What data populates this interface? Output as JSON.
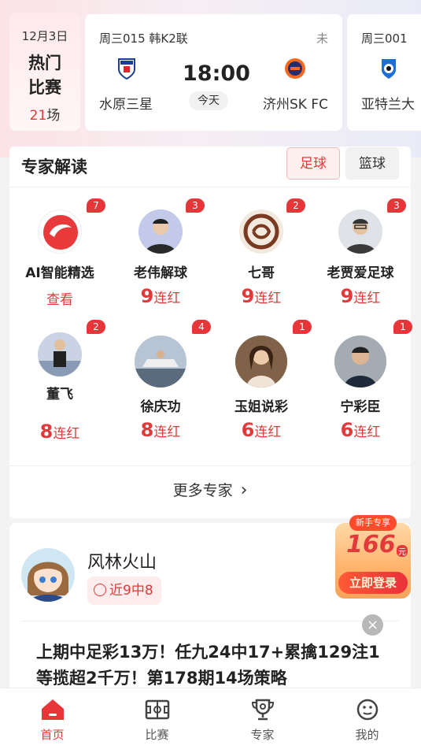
{
  "hot_matches": {
    "date": "12月3日",
    "title_line1": "热门",
    "title_line2": "比赛",
    "count": "21",
    "count_unit": "场",
    "matches": [
      {
        "league": "周三015 韩K2联",
        "status": "未",
        "home": "水原三星",
        "away": "济州SK FC",
        "time": "18:00",
        "day": "今天"
      },
      {
        "league": "周三001",
        "home": "亚特兰大"
      }
    ]
  },
  "expert_section": {
    "title": "专家解读",
    "tabs": [
      {
        "label": "足球",
        "active": true
      },
      {
        "label": "篮球",
        "active": false
      }
    ],
    "experts": [
      {
        "name": "AI智能精选",
        "badge": "7",
        "action": "查看"
      },
      {
        "name": "老伟解球",
        "badge": "3",
        "streak": "9",
        "streak_label": "连红"
      },
      {
        "name": "七哥",
        "badge": "2",
        "streak": "9",
        "streak_label": "连红"
      },
      {
        "name": "老贾爱足球",
        "badge": "3",
        "streak": "9",
        "streak_label": "连红"
      },
      {
        "name": "董飞",
        "badge": "2",
        "streak": "8",
        "streak_label": "连红"
      },
      {
        "name": "徐庆功",
        "badge": "4",
        "streak": "8",
        "streak_label": "连红"
      },
      {
        "name": "玉姐说彩",
        "badge": "1",
        "streak": "6",
        "streak_label": "连红"
      },
      {
        "name": "宁彩臣",
        "badge": "1",
        "streak": "6",
        "streak_label": "连红"
      }
    ],
    "more_label": "更多专家",
    "more_arrow": "›"
  },
  "feed": {
    "author": "风林火山",
    "record": "近9中8",
    "text": "上期中足彩13万！任九24中17+累擒129注1等揽超2千万！第178期14场策略"
  },
  "promo": {
    "tag": "新手专享",
    "amount": "166",
    "unit": "元",
    "button": "立即登录",
    "close": "×"
  },
  "bottom_nav": [
    {
      "label": "首页",
      "icon": "home-icon",
      "active": true
    },
    {
      "label": "比赛",
      "icon": "match-icon",
      "active": false
    },
    {
      "label": "专家",
      "icon": "trophy-icon",
      "active": false
    },
    {
      "label": "我的",
      "icon": "profile-icon",
      "active": false
    }
  ],
  "colors": {
    "accent": "#e23a3a",
    "badge": "#e8353a",
    "background": "#f3f3f3"
  }
}
